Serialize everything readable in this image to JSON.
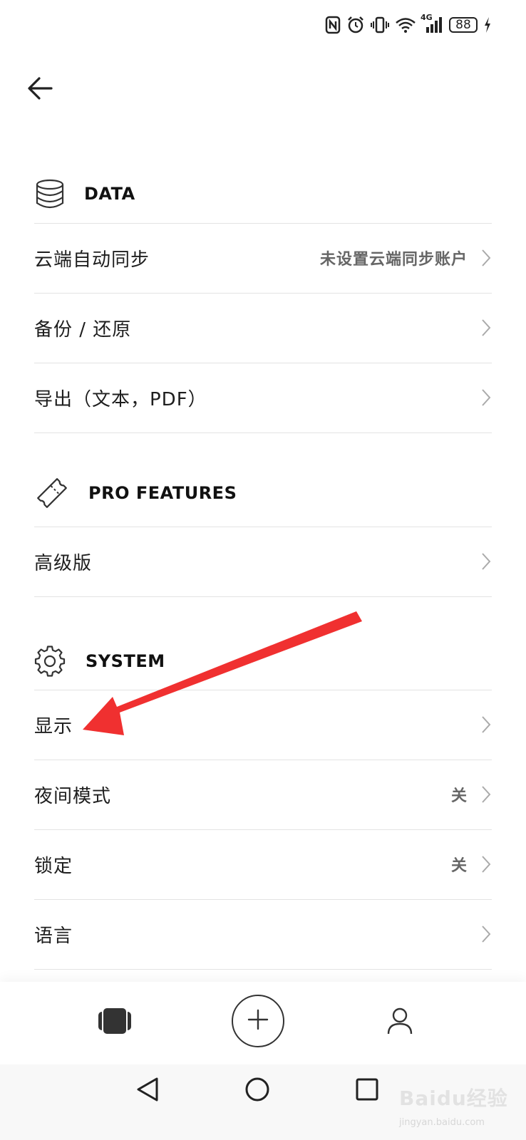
{
  "status": {
    "battery": "88",
    "network": "4G"
  },
  "sections": {
    "data": {
      "title": "DATA",
      "rows": [
        {
          "label": "云端自动同步",
          "value": "未设置云端同步账户"
        },
        {
          "label": "备份 / 还原"
        },
        {
          "label": "导出（文本，PDF）"
        }
      ]
    },
    "pro": {
      "title": "PRO FEATURES",
      "rows": [
        {
          "label": "高级版"
        }
      ]
    },
    "system": {
      "title": "SYSTEM",
      "rows": [
        {
          "label": "显示"
        },
        {
          "label": "夜间模式",
          "value": "关"
        },
        {
          "label": "锁定",
          "value": "关"
        },
        {
          "label": "语言"
        }
      ]
    }
  },
  "annotation": {
    "color": "#f03030"
  },
  "watermark": {
    "text": "Baidu经验",
    "url": "jingyan.baidu.com"
  }
}
